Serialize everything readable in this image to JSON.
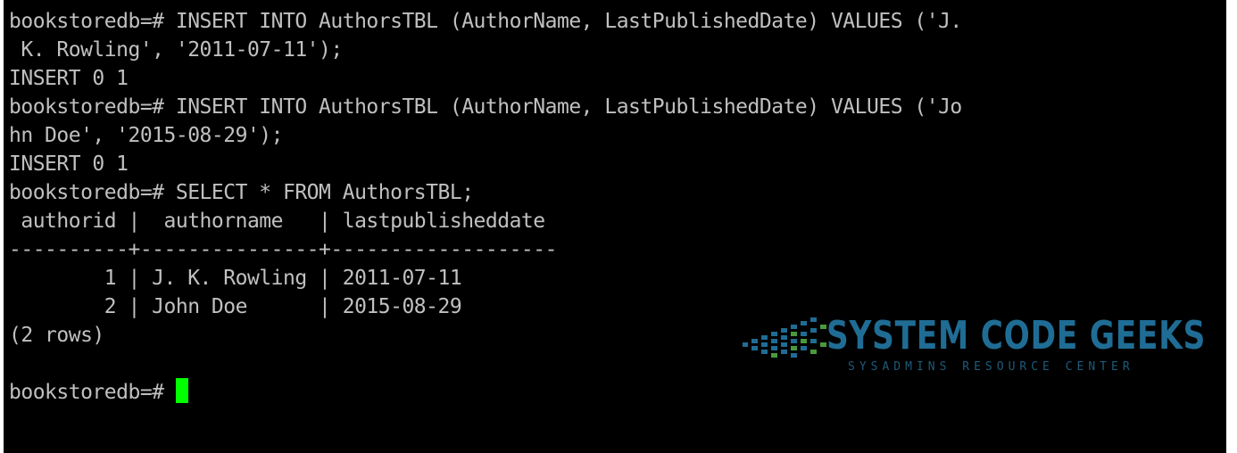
{
  "terminal": {
    "lines": [
      "bookstoredb=# INSERT INTO AuthorsTBL (AuthorName, LastPublishedDate) VALUES ('J.",
      " K. Rowling', '2011-07-11');",
      "INSERT 0 1",
      "bookstoredb=# INSERT INTO AuthorsTBL (AuthorName, LastPublishedDate) VALUES ('Jo",
      "hn Doe', '2015-08-29');",
      "INSERT 0 1",
      "bookstoredb=# SELECT * FROM AuthorsTBL;",
      " authorid |  authorname   | lastpublisheddate",
      "----------+---------------+-------------------",
      "        1 | J. K. Rowling | 2011-07-11",
      "        2 | John Doe      | 2015-08-29",
      "(2 rows)",
      "",
      "bookstoredb=# "
    ],
    "colors": {
      "background": "#000000",
      "text": "#c0c0c0",
      "cursor": "#00ff00"
    }
  },
  "watermark": {
    "title": "SYSTEM CODE GEEKS",
    "subtitle": "SYSADMINS RESOURCE CENTER",
    "color": "#1f6d95"
  }
}
